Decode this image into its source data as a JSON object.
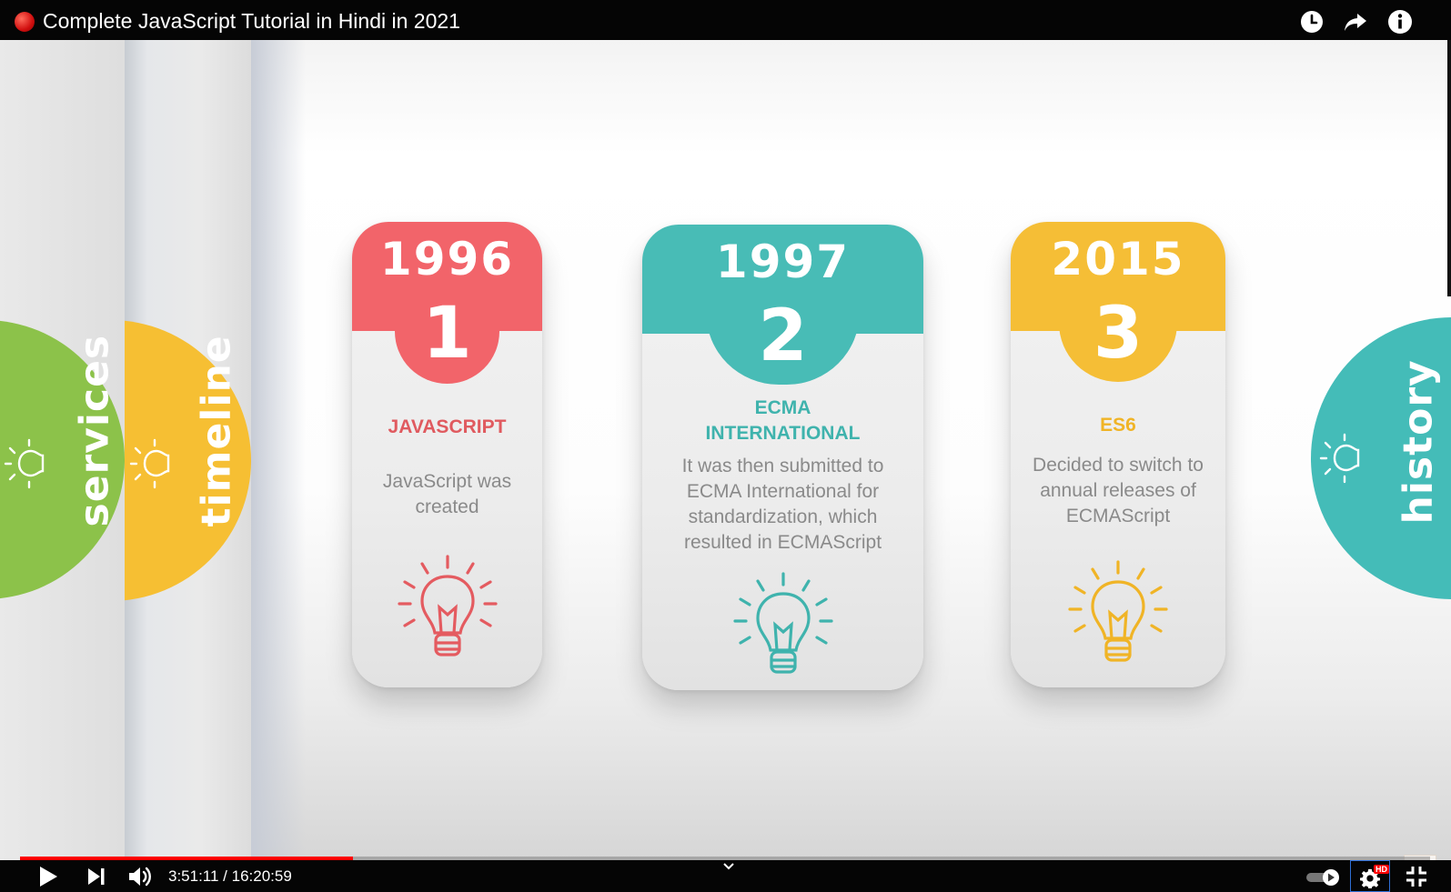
{
  "window": {
    "title": "Complete JavaScript Tutorial in Hindi in 2021"
  },
  "top_icons": [
    "watch-later-icon",
    "share-icon",
    "info-icon"
  ],
  "side_tabs": [
    {
      "label": "services",
      "color": "#8cc24a"
    },
    {
      "label": "timeline",
      "color": "#f6bf33"
    },
    {
      "label": "history",
      "color": "#44bcb8"
    }
  ],
  "cards": [
    {
      "year": "1996",
      "number": "1",
      "heading": "JAVASCRIPT",
      "description": "JavaScript was created",
      "color": "#f2646a",
      "heading_color": "#e05a5f"
    },
    {
      "year": "1997",
      "number": "2",
      "heading": "ECMA INTERNATIONAL",
      "description": "It was then submitted to ECMA International for standardization, which resulted in ECMAScript",
      "color": "#48bcb6",
      "heading_color": "#3fb3ad"
    },
    {
      "year": "2015",
      "number": "3",
      "heading": "ES6",
      "description": "Decided to switch to annual releases of ECMAScript",
      "color": "#f5be36",
      "heading_color": "#f0b426"
    }
  ],
  "player": {
    "time": "3:51:11 / 16:20:59",
    "progress": 0.236,
    "controls": [
      "play-icon",
      "next-icon",
      "volume-icon",
      "chevron-icon",
      "autoplay-toggle",
      "settings-icon",
      "exit-fullscreen-icon"
    ],
    "quality_badge": "HD"
  }
}
